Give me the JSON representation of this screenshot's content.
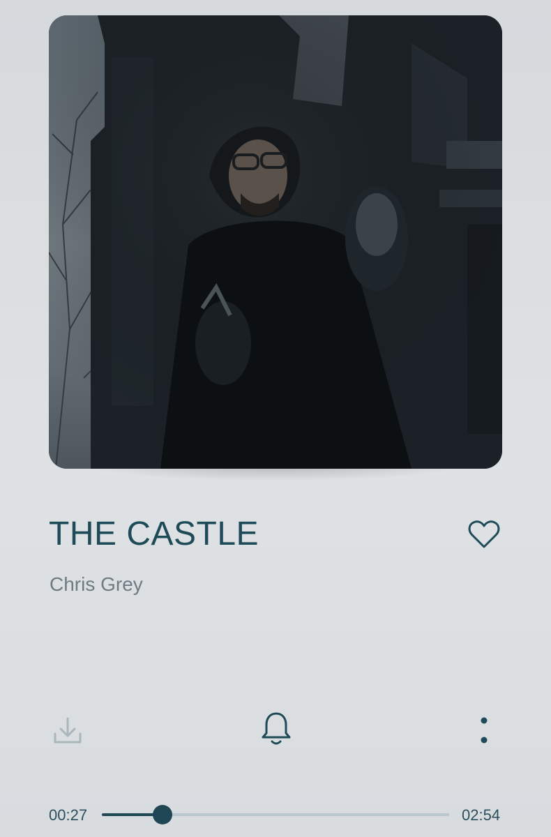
{
  "track": {
    "title": "THE CASTLE",
    "artist": "Chris Grey"
  },
  "icons": {
    "favorite": "heart-outline-icon",
    "download": "download-icon",
    "notify": "bell-icon",
    "more": "more-vertical-icon"
  },
  "playback": {
    "current_time": "00:27",
    "total_time": "02:54",
    "progress_fraction": 0.175
  },
  "colors": {
    "accent": "#1e4653",
    "title": "#1f4a57",
    "artist": "#6e7b82",
    "track_bg": "#b7c7cd"
  }
}
